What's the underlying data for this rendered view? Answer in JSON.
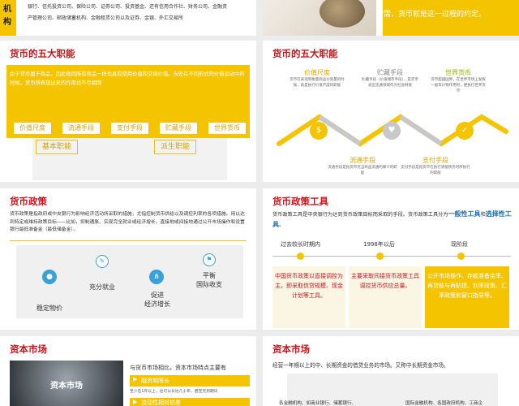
{
  "slide1": {
    "side_label": "机\n构",
    "text_line1": "银行、信托投资公司、保险公司、证券公司、投资基金、还有信用合作社、财务公司、金融资",
    "text_line2": "产管理公司、邮政储蓄机构、金融租赁公司以及证券、金银、外汇交易所",
    "right_text": "所需，货币就是这一过程的约定。"
  },
  "slide2": {
    "title": "货币的五大职能",
    "intro": "由于货币属于商品，因此他同所有商品一样也具有使用价值和交换价值。当处在不同形式的价值运动中的时候，货币所表现出来的作用也不尽相同",
    "tags": [
      "价值尺度",
      "流通手段",
      "支付手段",
      "贮藏手段",
      "世界货币"
    ],
    "basic": "基本职能",
    "derived": "派生职能"
  },
  "slide3": {
    "title": "货币的五大职能",
    "top_items": [
      {
        "name": "价值尺度",
        "desc": "货币在表现和衡量商品价值量的时候，就是执行价值尺度的职能"
      },
      {
        "name": "贮藏手段",
        "desc": "贮藏手段（价值储存手段），是货币退出流通领域作为社会财富"
      },
      {
        "name": "世界货币",
        "desc": "货币超越国界，在世界市场上发挥一般等价物作用时，便执行世界货币"
      }
    ],
    "bottom_items": [
      {
        "name": "流通手段",
        "desc": "流通手段是指货币充当商品流通的媒介的职能"
      },
      {
        "name": "支付手段",
        "desc": "支付手段是指货币在执行清偿债务时所执行的职能"
      }
    ],
    "icons": {
      "a": "dollar-icon",
      "b": "heart-icon",
      "c": "twitter-icon",
      "d": "cart-icon",
      "e": "mail-icon"
    }
  },
  "slide4": {
    "title": "货币政策",
    "intro": "货币政策是指政府或中央银行为影响经济活动所采取的措施，尤指控制货币供给以及调控利率的各项措施。用以达到特定或维持政策目标——比如，抑制通胀、实现完全就业或经济增长。直接地或间接地通过公开市场操作和设置银行最低准备金（最低储备金）。",
    "items": [
      "稳定物价",
      "充分就业",
      "促进\n经济增长",
      "平衡\n国际收支"
    ]
  },
  "slide5": {
    "title": "货币政策工具",
    "intro_a": "货币政策工具是中央银行为达到货币政策目标而采取的手段。货币政策工具分为",
    "intro_b": "一般性工具",
    "intro_c": "和",
    "intro_d": "选择性工具",
    "intro_e": "。",
    "periods": [
      "过去较长时期内",
      "1998年以后",
      "现阶段"
    ],
    "boxes": [
      "中国货币政策以直接调控为主，即采取信贷规模、现金计划等工具。",
      "主要采取间接货币政策工具调控货币供应总量。",
      "公开市场操作、存款准备金率、再贷款与再贴现、利率政策、汇率政策和窗口指导等。"
    ]
  },
  "slide6": {
    "title": "资本市场",
    "photo_label": "资本市场",
    "text": "与货币市场相比，资本市场特点主要有",
    "item1": "融资期限长",
    "item1_desc": "至少在1年以上，也可以长达几十年，甚至无到期日",
    "item2": "流动性相对较差"
  },
  "slide7": {
    "title": "资本市场",
    "text": "经营一年期以上的中、长期资金的借贷业务的市场。又称中长期资金市场。",
    "left_bottom": "各金融机构、如商业银行、储蓄银行、",
    "right_bottom": "国际金融机构、各国政府机构、工商企"
  }
}
